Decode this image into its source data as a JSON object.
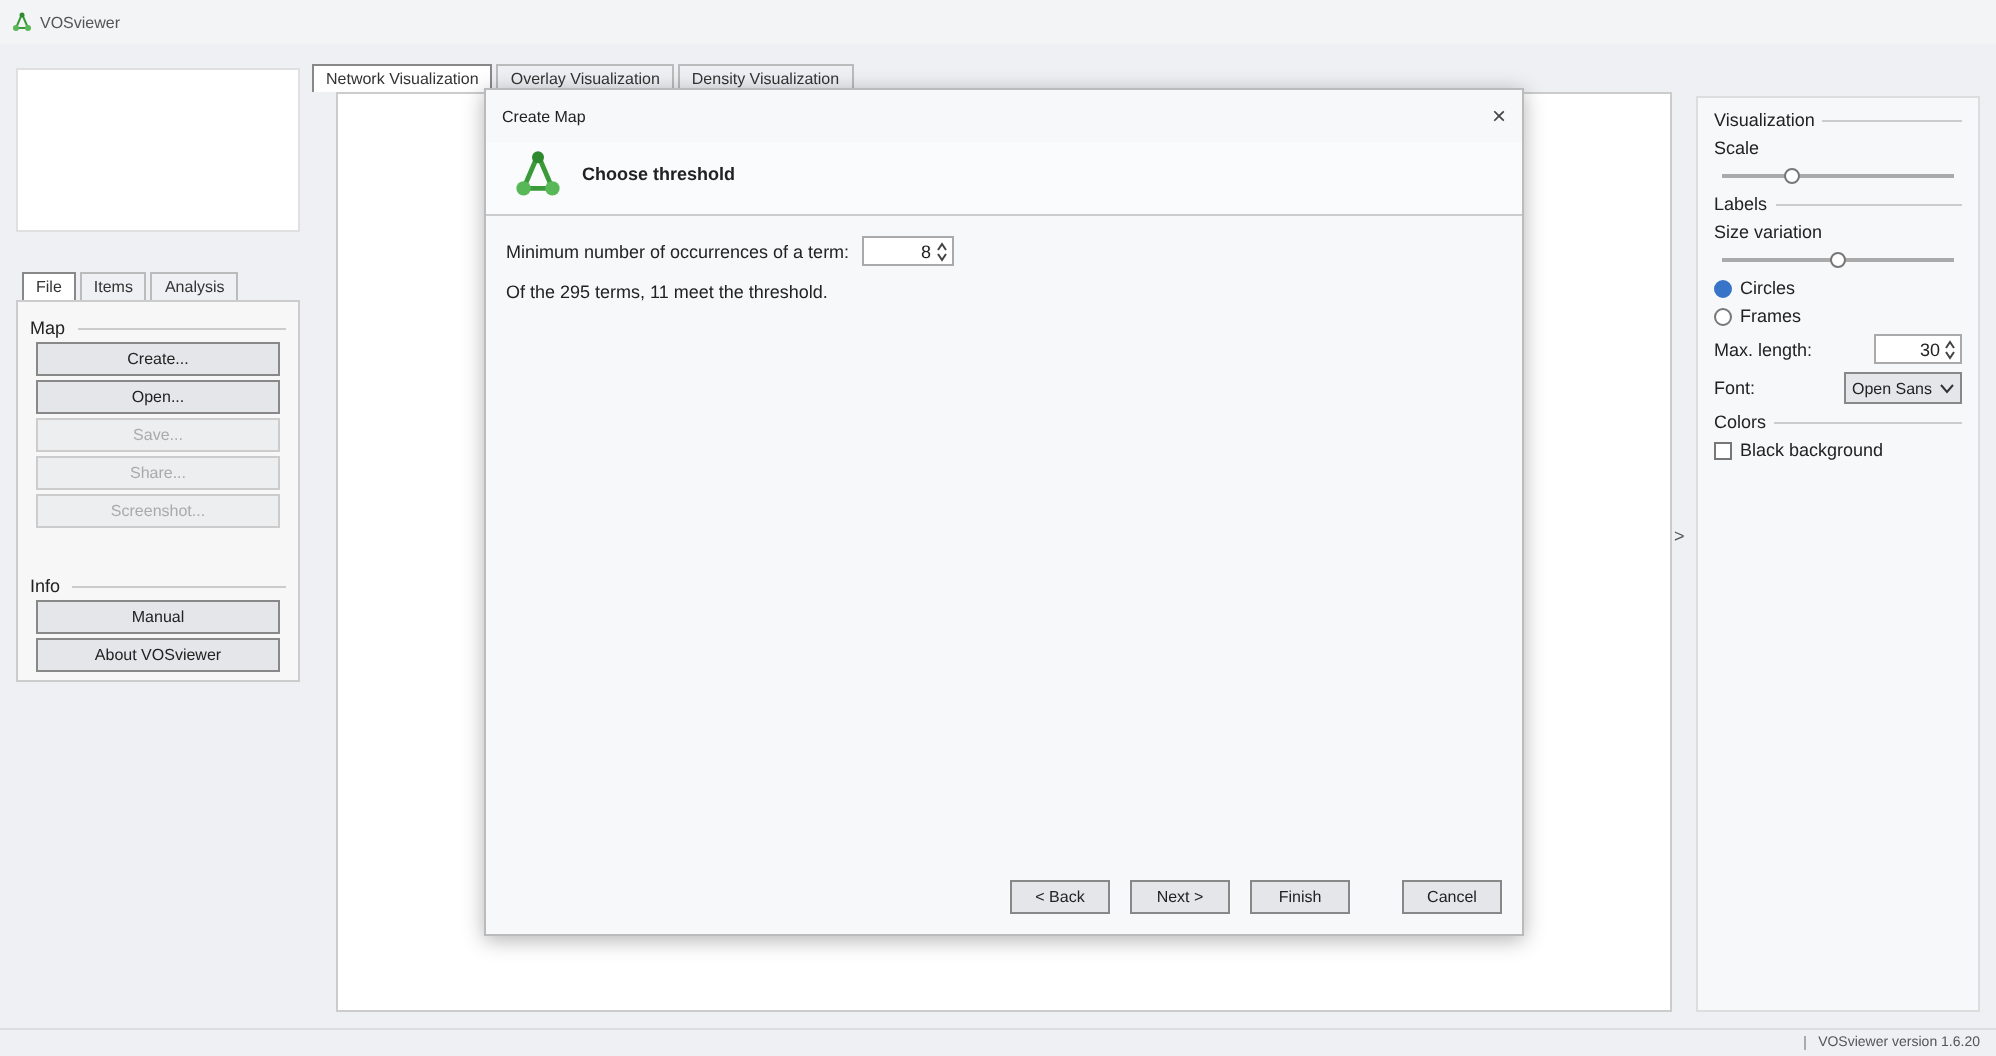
{
  "window": {
    "title": "VOSviewer"
  },
  "tabs": [
    {
      "label": "Network Visualization",
      "selected": true
    },
    {
      "label": "Overlay Visualization",
      "selected": false
    },
    {
      "label": "Density Visualization",
      "selected": false
    }
  ],
  "sidebar": {
    "tabs": [
      {
        "label": "File",
        "selected": true
      },
      {
        "label": "Items",
        "selected": false
      },
      {
        "label": "Analysis",
        "selected": false
      }
    ],
    "sections": [
      {
        "title": "Map",
        "buttons": [
          {
            "label": "Create...",
            "disabled": false
          },
          {
            "label": "Open...",
            "disabled": false
          },
          {
            "label": "Save...",
            "disabled": true
          },
          {
            "label": "Share...",
            "disabled": true
          },
          {
            "label": "Screenshot...",
            "disabled": true
          }
        ]
      },
      {
        "title": "Info",
        "buttons": [
          {
            "label": "Manual",
            "disabled": false
          },
          {
            "label": "About VOSviewer",
            "disabled": false
          }
        ]
      }
    ]
  },
  "dialog": {
    "title": "Create Map",
    "close": "×",
    "heading": "Choose threshold",
    "field_label": "Minimum number of occurrences of a term:",
    "field_value": "8",
    "summary": "Of the 295 terms, 11 meet the threshold.",
    "buttons": [
      "< Back",
      "Next >",
      "Finish",
      "Cancel"
    ]
  },
  "options": {
    "items": [
      {
        "kind": "header",
        "label": "Visualization"
      },
      {
        "kind": "label",
        "label": "Scale"
      },
      {
        "kind": "slider",
        "level": 0.3
      },
      {
        "kind": "header",
        "label": "Labels"
      },
      {
        "kind": "label",
        "label": "Size variation"
      },
      {
        "kind": "slider",
        "level": 0.5
      },
      {
        "kind": "radio",
        "label": "Circles",
        "selected": true
      },
      {
        "kind": "radio",
        "label": "Frames",
        "selected": false
      },
      {
        "kind": "spinner",
        "label": "Max. length:",
        "value": "30"
      },
      {
        "kind": "dropdown",
        "label": "Font:",
        "value": "Open Sans"
      },
      {
        "kind": "header",
        "label": "Colors"
      },
      {
        "kind": "checkbox",
        "label": "Black background",
        "checked": false
      }
    ],
    "collapse": ">"
  },
  "status_bar": {
    "text": "VOSviewer version 1.6.20"
  }
}
